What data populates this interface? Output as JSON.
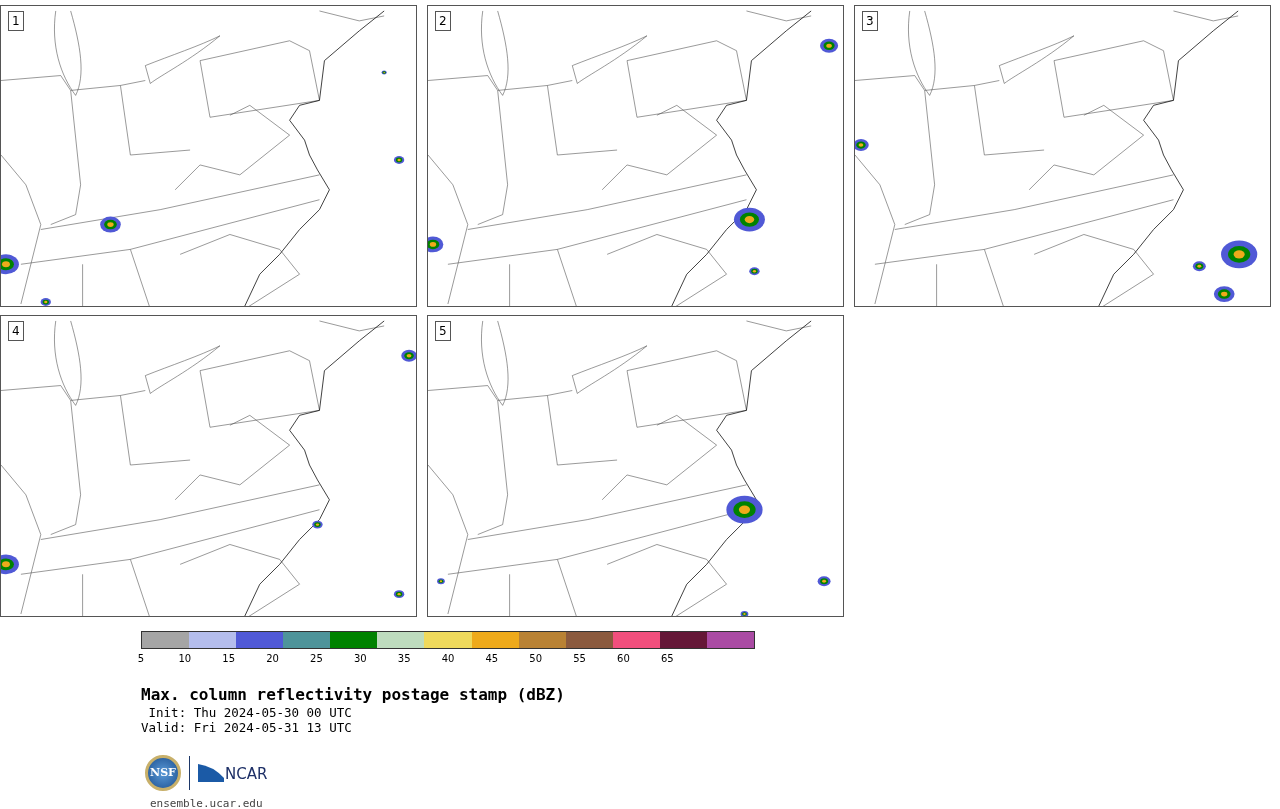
{
  "panels": [
    {
      "label": "1"
    },
    {
      "label": "2"
    },
    {
      "label": "3"
    },
    {
      "label": "4"
    },
    {
      "label": "5"
    }
  ],
  "colorbar": {
    "segments": [
      {
        "color": "#a5a5a5"
      },
      {
        "color": "#b4bdec"
      },
      {
        "color": "#5059d6"
      },
      {
        "color": "#4e949a"
      },
      {
        "color": "#008200"
      },
      {
        "color": "#bedcbe"
      },
      {
        "color": "#efd95c"
      },
      {
        "color": "#efaa1b"
      },
      {
        "color": "#b98234"
      },
      {
        "color": "#8b5a3e"
      },
      {
        "color": "#f24f7d"
      },
      {
        "color": "#651838"
      },
      {
        "color": "#aa4ba4"
      }
    ],
    "tick_labels": [
      "5",
      "10",
      "15",
      "20",
      "25",
      "30",
      "35",
      "40",
      "45",
      "50",
      "55",
      "60",
      "65"
    ]
  },
  "title": "Max. column reflectivity postage stamp (dBZ)",
  "init": " Init: Thu 2024-05-30 00 UTC",
  "valid": "Valid: Fri 2024-05-31 13 UTC",
  "logos": {
    "nsf": "NSF",
    "ncar": "NCAR"
  },
  "url": "ensemble.ucar.edu"
}
